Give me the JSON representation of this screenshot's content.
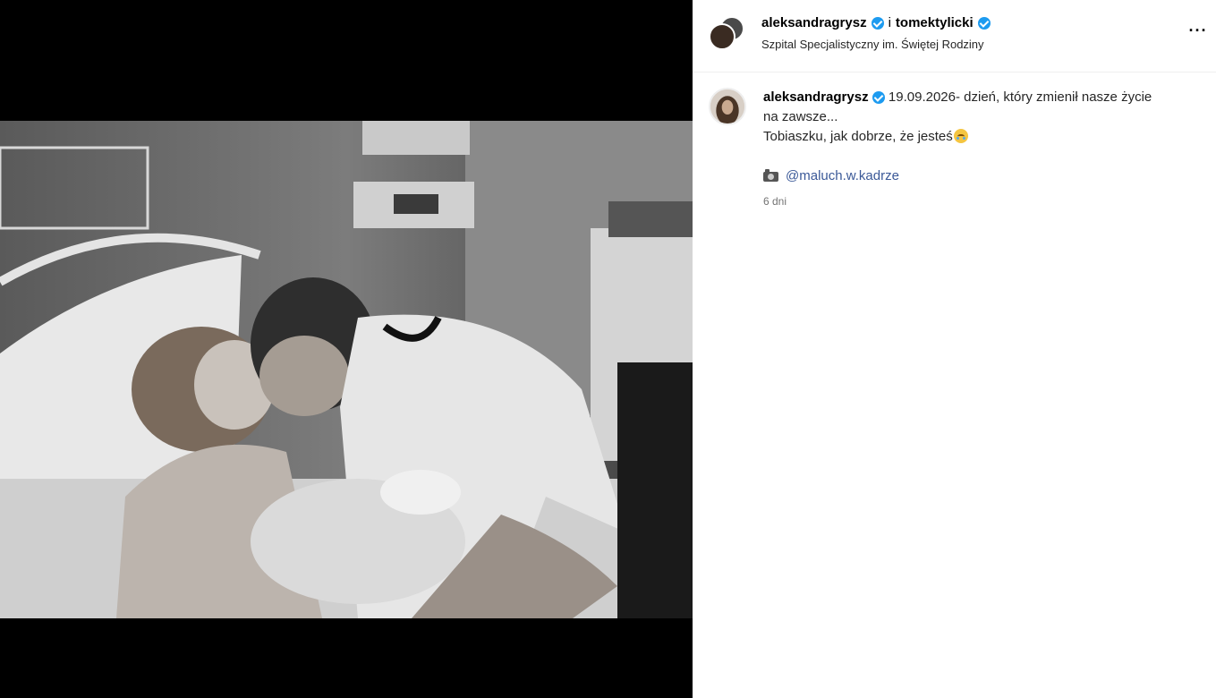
{
  "post": {
    "author": "aleksandragrysz",
    "conjunction": "i",
    "coauthor": "tomektylicki",
    "location": "Szpital Specjalistyczny im. Świętej Rodziny",
    "more_label": "···"
  },
  "caption": {
    "username": "aleksandragrysz",
    "line1": "19.09.2026- dzień, który zmienił nasze życie",
    "line2": "na zawsze...",
    "line3": "Tobiaszku, jak dobrze, że jesteś",
    "emoji": "face-holding-back-tears",
    "credit_icon": "camera-icon",
    "mention": "@maluch.w.kadrze",
    "time": "6 dni"
  },
  "colors": {
    "verified": "#1d9bf0",
    "mention": "#3b5998",
    "media_bg": "#000000"
  }
}
